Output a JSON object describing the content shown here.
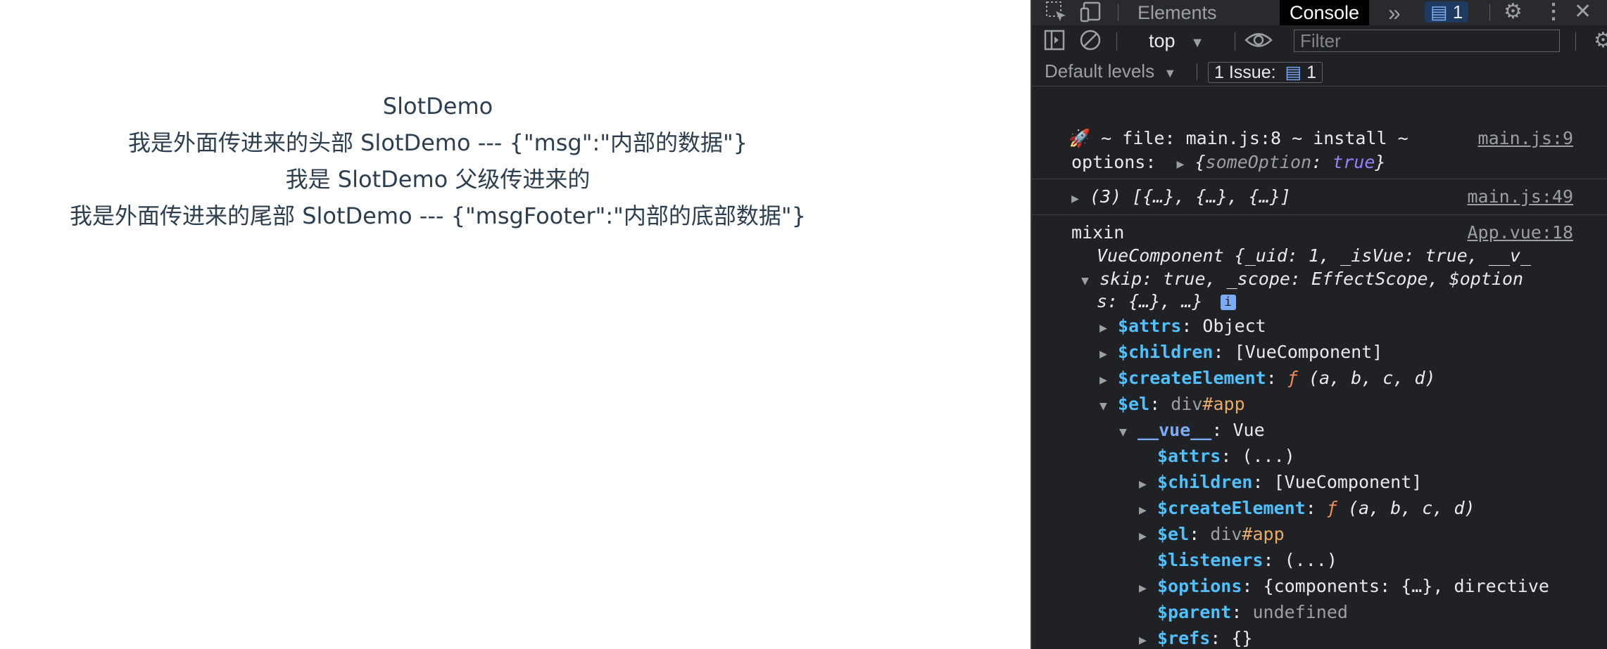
{
  "page": {
    "lines": [
      "SlotDemo",
      "我是外面传进来的头部 SlotDemo --- {\"msg\":\"内部的数据\"}",
      "我是 SlotDemo 父级传进来的",
      "我是外面传进来的尾部 SlotDemo --- {\"msgFooter\":\"内部的底部数据\"}"
    ]
  },
  "devtools": {
    "tabs": [
      "Elements",
      "Console"
    ],
    "active_tab": "Console",
    "more_tabs": "»",
    "message_count": "1",
    "context": "top",
    "filter_placeholder": "Filter",
    "default_levels": "Default levels",
    "issues_label": "1 Issue:",
    "issues_count": "1",
    "colors": {
      "bg": "#202124",
      "accent": "#4fc1ff",
      "bool": "#9980ff",
      "fn": "#f28b54"
    }
  },
  "console": {
    "log1": {
      "text": "🚀 ~ file: main.js:8 ~ install ~",
      "label": "options:",
      "obj_key": "someOption",
      "obj_val": "true",
      "source": "main.js:9"
    },
    "log2": {
      "text": "(3) [{…}, {…}, {…}]",
      "source": "main.js:49"
    },
    "log3": {
      "label": "mixin",
      "source": "App.vue:18",
      "summary1": "VueComponent {_uid: 1, _isVue: true, __v_",
      "summary2": "skip: true, _scope: EffectScope, $option",
      "summary3": "s: {…}, …}",
      "props": [
        {
          "key": "$attrs",
          "val": "Object"
        },
        {
          "key": "$children",
          "val": "[VueComponent]"
        },
        {
          "key": "$createElement",
          "val": "(a, b, c, d)"
        },
        {
          "key": "$el",
          "val": "div#app"
        }
      ],
      "vue_key": "__vue__",
      "vue_val": "Vue",
      "nested": [
        {
          "key": "$attrs",
          "val": "(...)"
        },
        {
          "key": "$children",
          "val": "[VueComponent]"
        },
        {
          "key": "$createElement",
          "val": "(a, b, c, d)"
        },
        {
          "key": "$el",
          "val": "div#app"
        },
        {
          "key": "$listeners",
          "val": "(...)"
        },
        {
          "key": "$options",
          "val": "{components: {…}, directive"
        },
        {
          "key": "$parent",
          "val": "undefined"
        },
        {
          "key": "$refs",
          "val": "{}"
        }
      ]
    }
  }
}
